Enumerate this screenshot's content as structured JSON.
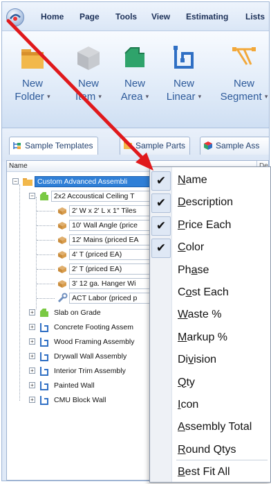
{
  "menubar": {
    "items": [
      "Home",
      "Page",
      "Tools",
      "View",
      "Estimating",
      "Lists"
    ]
  },
  "ribbon": {
    "buttons": [
      {
        "line1": "New",
        "line2": "Folder",
        "icon": "folder-icon"
      },
      {
        "line1": "New",
        "line2": "Item",
        "icon": "cube-icon"
      },
      {
        "line1": "New",
        "line2": "Area",
        "icon": "area-icon"
      },
      {
        "line1": "New",
        "line2": "Linear",
        "icon": "linear-icon"
      },
      {
        "line1": "New",
        "line2": "Segment",
        "icon": "segment-icon"
      }
    ]
  },
  "tabs": [
    "Sample Templates",
    "Sample Parts",
    "Sample Ass"
  ],
  "tree": {
    "header_name": "Name",
    "header_desc": "De",
    "rows": [
      {
        "label": "Custom Advanced Assembli",
        "selected": true
      },
      {
        "label": "2x2 Accoustical Ceiling T"
      },
      {
        "label": "2' W x 2' L x 1\" Tiles"
      },
      {
        "label": "10' Wall Angle (price"
      },
      {
        "label": "12' Mains (priced EA"
      },
      {
        "label": "4' T (priced EA)"
      },
      {
        "label": "2' T (priced EA)"
      },
      {
        "label": "3' 12 ga. Hanger Wi"
      },
      {
        "label": "ACT Labor (priced p"
      },
      {
        "label": "Slab on Grade"
      },
      {
        "label": "Concrete Footing Assem"
      },
      {
        "label": "Wood Framing Assembly"
      },
      {
        "label": "Drywall Wall Assembly"
      },
      {
        "label": "Interior Trim Assembly"
      },
      {
        "label": "Painted Wall"
      },
      {
        "label": "CMU Block Wall"
      }
    ]
  },
  "context_menu": {
    "items": [
      {
        "pre": "",
        "u": "N",
        "post": "ame",
        "checked": true
      },
      {
        "pre": "",
        "u": "D",
        "post": "escription",
        "checked": true
      },
      {
        "pre": "",
        "u": "P",
        "post": "rice Each",
        "checked": true
      },
      {
        "pre": "",
        "u": "C",
        "post": "olor",
        "checked": true
      },
      {
        "pre": "Ph",
        "u": "a",
        "post": "se",
        "checked": false
      },
      {
        "pre": "C",
        "u": "o",
        "post": "st Each",
        "checked": false
      },
      {
        "pre": "",
        "u": "W",
        "post": "aste %",
        "checked": false
      },
      {
        "pre": "",
        "u": "M",
        "post": "arkup %",
        "checked": false
      },
      {
        "pre": "Di",
        "u": "v",
        "post": "ision",
        "checked": false
      },
      {
        "pre": "",
        "u": "Q",
        "post": "ty",
        "checked": false
      },
      {
        "pre": "",
        "u": "I",
        "post": "con",
        "checked": false
      },
      {
        "pre": "",
        "u": "A",
        "post": "ssembly Total",
        "checked": false
      },
      {
        "pre": "",
        "u": "R",
        "post": "ound Qtys",
        "checked": false
      },
      {
        "pre": "",
        "u": "B",
        "post": "est Fit All",
        "checked": false
      }
    ],
    "check_glyph": "✔"
  },
  "colors": {
    "selection": "#2f7fd7",
    "arrow": "#e0191c",
    "ribbon_label": "#2d5a9a"
  }
}
